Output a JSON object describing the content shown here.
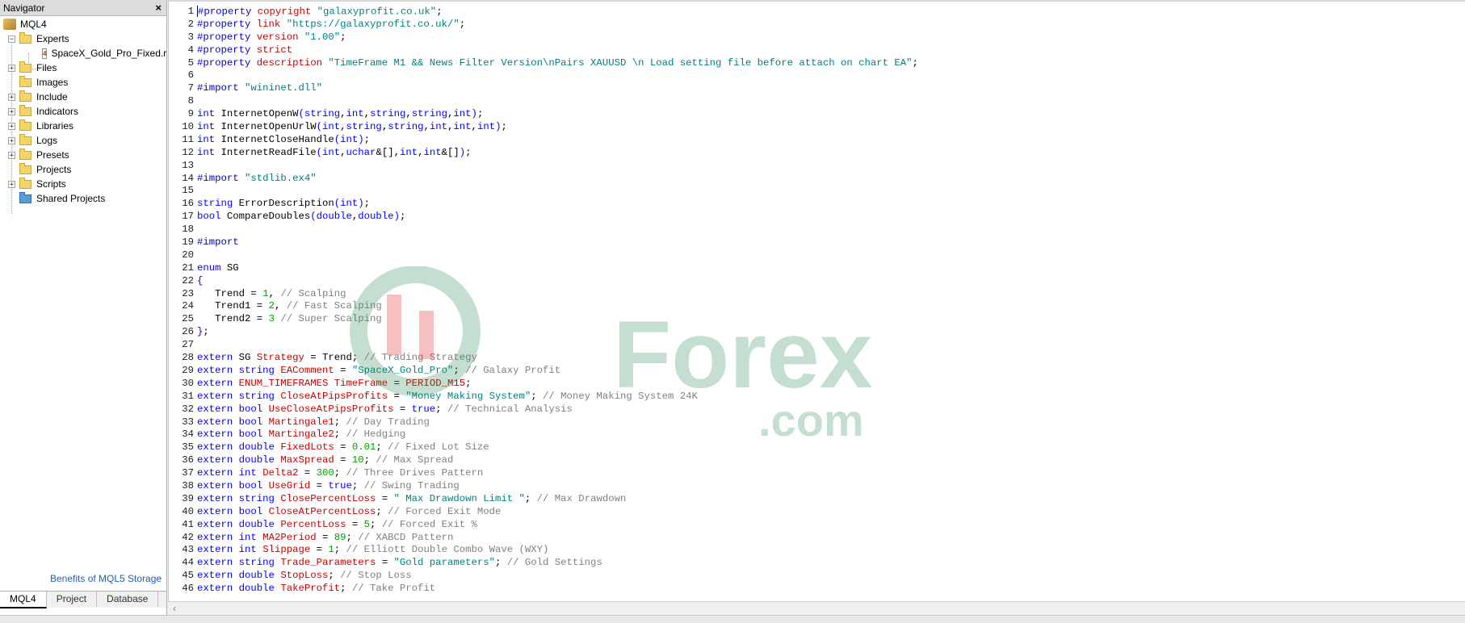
{
  "navigator": {
    "title": "Navigator",
    "close_glyph": "×",
    "root": "MQL4",
    "experts": "Experts",
    "expert_file": "SpaceX_Gold_Pro_Fixed.r",
    "folders": [
      "Files",
      "Images",
      "Include",
      "Indicators",
      "Libraries",
      "Logs",
      "Presets",
      "Projects",
      "Scripts",
      "Shared Projects"
    ],
    "link": "Benefits of MQL5 Storage",
    "tabs": [
      "MQL4",
      "Project",
      "Database"
    ],
    "active_tab": "MQL4"
  },
  "watermark": {
    "text_main": "Forex",
    "text_sub": ".com"
  },
  "code_lines": [
    [
      [
        "pre",
        "#property "
      ],
      [
        "id",
        "copyright "
      ],
      [
        "str",
        "\"galaxyprofit.co.uk\""
      ],
      [
        "def",
        ";"
      ]
    ],
    [
      [
        "pre",
        "#property "
      ],
      [
        "id",
        "link "
      ],
      [
        "str",
        "\"https://galaxyprofit.co.uk/\""
      ],
      [
        "def",
        ";"
      ]
    ],
    [
      [
        "pre",
        "#property "
      ],
      [
        "id",
        "version "
      ],
      [
        "str",
        "\"1.00\""
      ],
      [
        "def",
        ";"
      ]
    ],
    [
      [
        "pre",
        "#property "
      ],
      [
        "id",
        "strict"
      ]
    ],
    [
      [
        "pre",
        "#property "
      ],
      [
        "id",
        "description "
      ],
      [
        "str",
        "\"TimeFrame M1 && News Filter Version\\nPairs XAUUSD \\n Load setting file before attach on chart EA\""
      ],
      [
        "def",
        ";"
      ]
    ],
    [],
    [
      [
        "pre",
        "#import "
      ],
      [
        "str",
        "\"wininet.dll\""
      ]
    ],
    [],
    [
      [
        "kw",
        "int "
      ],
      [
        "def",
        "InternetOpenW"
      ],
      [
        "kw",
        "("
      ],
      [
        "kw",
        "string"
      ],
      [
        "def",
        ","
      ],
      [
        "kw",
        "int"
      ],
      [
        "def",
        ","
      ],
      [
        "kw",
        "string"
      ],
      [
        "def",
        ","
      ],
      [
        "kw",
        "string"
      ],
      [
        "def",
        ","
      ],
      [
        "kw",
        "int"
      ],
      [
        "kw",
        ")"
      ],
      [
        "def",
        ";"
      ]
    ],
    [
      [
        "kw",
        "int "
      ],
      [
        "def",
        "InternetOpenUrlW"
      ],
      [
        "kw",
        "("
      ],
      [
        "kw",
        "int"
      ],
      [
        "def",
        ","
      ],
      [
        "kw",
        "string"
      ],
      [
        "def",
        ","
      ],
      [
        "kw",
        "string"
      ],
      [
        "def",
        ","
      ],
      [
        "kw",
        "int"
      ],
      [
        "def",
        ","
      ],
      [
        "kw",
        "int"
      ],
      [
        "def",
        ","
      ],
      [
        "kw",
        "int"
      ],
      [
        "kw",
        ")"
      ],
      [
        "def",
        ";"
      ]
    ],
    [
      [
        "kw",
        "int "
      ],
      [
        "def",
        "InternetCloseHandle"
      ],
      [
        "kw",
        "("
      ],
      [
        "kw",
        "int"
      ],
      [
        "kw",
        ")"
      ],
      [
        "def",
        ";"
      ]
    ],
    [
      [
        "kw",
        "int "
      ],
      [
        "def",
        "InternetReadFile"
      ],
      [
        "kw",
        "("
      ],
      [
        "kw",
        "int"
      ],
      [
        "def",
        ","
      ],
      [
        "kw",
        "uchar"
      ],
      [
        "def",
        "&[],"
      ],
      [
        "kw",
        "int"
      ],
      [
        "def",
        ","
      ],
      [
        "kw",
        "int"
      ],
      [
        "def",
        "&[]"
      ],
      [
        "kw",
        ")"
      ],
      [
        "def",
        ";"
      ]
    ],
    [],
    [
      [
        "pre",
        "#import "
      ],
      [
        "str",
        "\"stdlib.ex4\""
      ]
    ],
    [],
    [
      [
        "kw",
        "string "
      ],
      [
        "def",
        "ErrorDescription"
      ],
      [
        "kw",
        "("
      ],
      [
        "kw",
        "int"
      ],
      [
        "kw",
        ")"
      ],
      [
        "def",
        ";"
      ]
    ],
    [
      [
        "kw",
        "bool "
      ],
      [
        "def",
        "CompareDoubles"
      ],
      [
        "kw",
        "("
      ],
      [
        "kw",
        "double"
      ],
      [
        "def",
        ","
      ],
      [
        "kw",
        "double"
      ],
      [
        "kw",
        ")"
      ],
      [
        "def",
        ";"
      ]
    ],
    [],
    [
      [
        "pre",
        "#import"
      ]
    ],
    [],
    [
      [
        "kw",
        "enum "
      ],
      [
        "def",
        "SG"
      ]
    ],
    [
      [
        "kw",
        "{"
      ]
    ],
    [
      [
        "def",
        "   Trend = "
      ],
      [
        "num",
        "1"
      ],
      [
        "def",
        ", "
      ],
      [
        "com",
        "// Scalping"
      ]
    ],
    [
      [
        "def",
        "   Trend1 = "
      ],
      [
        "num",
        "2"
      ],
      [
        "def",
        ", "
      ],
      [
        "com",
        "// Fast Scalping"
      ]
    ],
    [
      [
        "def",
        "   Trend2 = "
      ],
      [
        "num",
        "3"
      ],
      [
        "def",
        " "
      ],
      [
        "com",
        "// Super Scalping"
      ]
    ],
    [
      [
        "kw",
        "}"
      ],
      [
        "def",
        ";"
      ]
    ],
    [],
    [
      [
        "kw",
        "extern "
      ],
      [
        "def",
        "SG "
      ],
      [
        "id",
        "Strategy"
      ],
      [
        "def",
        " = Trend; "
      ],
      [
        "com",
        "// Trading Strategy"
      ]
    ],
    [
      [
        "kw",
        "extern "
      ],
      [
        "kw",
        "string "
      ],
      [
        "id",
        "EAComment"
      ],
      [
        "def",
        " = "
      ],
      [
        "str",
        "\"SpaceX_Gold_Pro\""
      ],
      [
        "def",
        "; "
      ],
      [
        "com",
        "// Galaxy Profit"
      ]
    ],
    [
      [
        "kw",
        "extern "
      ],
      [
        "id",
        "ENUM_TIMEFRAMES "
      ],
      [
        "id",
        "TimeFrame"
      ],
      [
        "def",
        " = "
      ],
      [
        "id",
        "PERIOD_M15"
      ],
      [
        "def",
        ";"
      ]
    ],
    [
      [
        "kw",
        "extern "
      ],
      [
        "kw",
        "string "
      ],
      [
        "id",
        "CloseAtPipsProfits"
      ],
      [
        "def",
        " = "
      ],
      [
        "str",
        "\"Money Making System\""
      ],
      [
        "def",
        "; "
      ],
      [
        "com",
        "// Money Making System 24K"
      ]
    ],
    [
      [
        "kw",
        "extern "
      ],
      [
        "kw",
        "bool "
      ],
      [
        "id",
        "UseCloseAtPipsProfits"
      ],
      [
        "def",
        " = "
      ],
      [
        "kw",
        "true"
      ],
      [
        "def",
        "; "
      ],
      [
        "com",
        "// Technical Analysis"
      ]
    ],
    [
      [
        "kw",
        "extern "
      ],
      [
        "kw",
        "bool "
      ],
      [
        "id",
        "Martingale1"
      ],
      [
        "def",
        "; "
      ],
      [
        "com",
        "// Day Trading"
      ]
    ],
    [
      [
        "kw",
        "extern "
      ],
      [
        "kw",
        "bool "
      ],
      [
        "id",
        "Martingale2"
      ],
      [
        "def",
        "; "
      ],
      [
        "com",
        "// Hedging"
      ]
    ],
    [
      [
        "kw",
        "extern "
      ],
      [
        "kw",
        "double "
      ],
      [
        "id",
        "FixedLots"
      ],
      [
        "def",
        " = "
      ],
      [
        "num",
        "0.01"
      ],
      [
        "def",
        "; "
      ],
      [
        "com",
        "// Fixed Lot Size"
      ]
    ],
    [
      [
        "kw",
        "extern "
      ],
      [
        "kw",
        "double "
      ],
      [
        "id",
        "MaxSpread"
      ],
      [
        "def",
        " = "
      ],
      [
        "num",
        "10"
      ],
      [
        "def",
        "; "
      ],
      [
        "com",
        "// Max Spread"
      ]
    ],
    [
      [
        "kw",
        "extern "
      ],
      [
        "kw",
        "int "
      ],
      [
        "id",
        "Delta2"
      ],
      [
        "def",
        " = "
      ],
      [
        "num",
        "300"
      ],
      [
        "def",
        "; "
      ],
      [
        "com",
        "// Three Drives Pattern"
      ]
    ],
    [
      [
        "kw",
        "extern "
      ],
      [
        "kw",
        "bool "
      ],
      [
        "id",
        "UseGrid"
      ],
      [
        "def",
        " = "
      ],
      [
        "kw",
        "true"
      ],
      [
        "def",
        "; "
      ],
      [
        "com",
        "// Swing Trading"
      ]
    ],
    [
      [
        "kw",
        "extern "
      ],
      [
        "kw",
        "string "
      ],
      [
        "id",
        "ClosePercentLoss"
      ],
      [
        "def",
        " = "
      ],
      [
        "str",
        "\" Max Drawdown Limit \""
      ],
      [
        "def",
        "; "
      ],
      [
        "com",
        "// Max Drawdown"
      ]
    ],
    [
      [
        "kw",
        "extern "
      ],
      [
        "kw",
        "bool "
      ],
      [
        "id",
        "CloseAtPercentLoss"
      ],
      [
        "def",
        "; "
      ],
      [
        "com",
        "// Forced Exit Mode"
      ]
    ],
    [
      [
        "kw",
        "extern "
      ],
      [
        "kw",
        "double "
      ],
      [
        "id",
        "PercentLoss"
      ],
      [
        "def",
        " = "
      ],
      [
        "num",
        "5"
      ],
      [
        "def",
        "; "
      ],
      [
        "com",
        "// Forced Exit %"
      ]
    ],
    [
      [
        "kw",
        "extern "
      ],
      [
        "kw",
        "int "
      ],
      [
        "id",
        "MA2Period"
      ],
      [
        "def",
        " = "
      ],
      [
        "num",
        "89"
      ],
      [
        "def",
        "; "
      ],
      [
        "com",
        "// XABCD Pattern"
      ]
    ],
    [
      [
        "kw",
        "extern "
      ],
      [
        "kw",
        "int "
      ],
      [
        "id",
        "Slippage"
      ],
      [
        "def",
        " = "
      ],
      [
        "num",
        "1"
      ],
      [
        "def",
        "; "
      ],
      [
        "com",
        "// Elliott Double Combo Wave (WXY)"
      ]
    ],
    [
      [
        "kw",
        "extern "
      ],
      [
        "kw",
        "string "
      ],
      [
        "id",
        "Trade_Parameters"
      ],
      [
        "def",
        " = "
      ],
      [
        "str",
        "\"Gold parameters\""
      ],
      [
        "def",
        "; "
      ],
      [
        "com",
        "// Gold Settings"
      ]
    ],
    [
      [
        "kw",
        "extern "
      ],
      [
        "kw",
        "double "
      ],
      [
        "id",
        "StopLoss"
      ],
      [
        "def",
        "; "
      ],
      [
        "com",
        "// Stop Loss"
      ]
    ],
    [
      [
        "kw",
        "extern "
      ],
      [
        "kw",
        "double "
      ],
      [
        "id",
        "TakeProfit"
      ],
      [
        "def",
        "; "
      ],
      [
        "com",
        "// Take Profit"
      ]
    ]
  ]
}
